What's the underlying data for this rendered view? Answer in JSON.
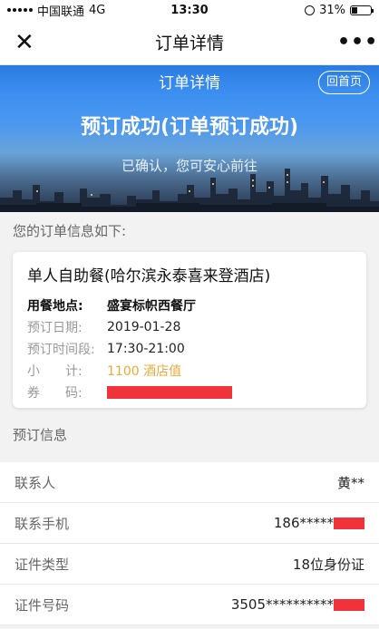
{
  "status_bar": {
    "carrier": "中国联通",
    "network": "4G",
    "time": "13:30",
    "battery": "31%",
    "battery_level": 0.31
  },
  "nav": {
    "title": "订单详情"
  },
  "hero": {
    "bar_title": "订单详情",
    "home_button": "回首页",
    "title": "预订成功(订单预订成功)",
    "subtitle": "已确认，您可安心前往"
  },
  "order_section_label": "您的订单信息如下:",
  "order_card": {
    "title": "单人自助餐(哈尔滨永泰喜来登酒店)",
    "rows": [
      {
        "label": "用餐地点:",
        "value": "盛宴标帜西餐厅"
      },
      {
        "label": "预订日期:",
        "value": "2019-01-28"
      },
      {
        "label": "预订时间段:",
        "value": "17:30-21:00"
      },
      {
        "label": "小　　计:",
        "value": "1100 酒店值"
      },
      {
        "label": "券　　码:",
        "value": ""
      }
    ]
  },
  "booking_section_label": "预订信息",
  "booking_info": [
    {
      "label": "联系人",
      "value": "黄**"
    },
    {
      "label": "联系手机",
      "value": "186*****"
    },
    {
      "label": "证件类型",
      "value": "18位身份证"
    },
    {
      "label": "证件号码",
      "value": "3505**********"
    }
  ],
  "colors": {
    "accent_blue": "#3b8ef0",
    "subtotal_orange": "#f0a83a",
    "redaction_red": "#f0323a"
  }
}
